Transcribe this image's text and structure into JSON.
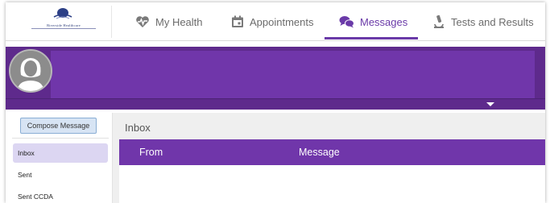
{
  "logo": {
    "text": "Riverside Healthcare",
    "icon": "globe-logo-icon"
  },
  "nav": {
    "tabs": [
      {
        "label": "My Health",
        "icon": "heart-pulse-icon"
      },
      {
        "label": "Appointments",
        "icon": "calendar-icon"
      },
      {
        "label": "Messages",
        "icon": "chat-bubbles-icon",
        "active": true
      },
      {
        "label": "Tests and Results",
        "icon": "microscope-icon"
      }
    ]
  },
  "profile": {
    "avatar_icon": "user-silhouette-icon",
    "expand_icon": "caret-down-icon"
  },
  "sidebar": {
    "compose_label": "Compose Message",
    "items": [
      {
        "label": "Inbox",
        "active": true
      },
      {
        "label": "Sent"
      },
      {
        "label": "Sent CCDA"
      }
    ]
  },
  "main": {
    "title": "Inbox",
    "columns": [
      "From",
      "Message"
    ]
  },
  "colors": {
    "accent": "#7036aa",
    "banner": "#5e2a8c",
    "compose_bg": "#d7e4f4",
    "active_item": "#dcd6f2"
  }
}
